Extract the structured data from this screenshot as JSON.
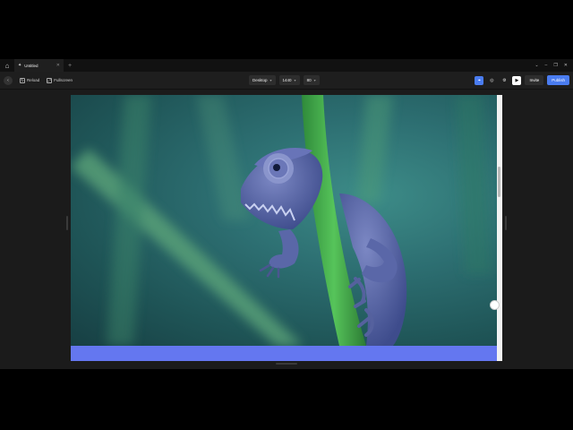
{
  "tabbar": {
    "tab_title": "Untitled",
    "window_controls": [
      "⌄",
      "–",
      "❐",
      "✕"
    ]
  },
  "toolbar": {
    "reload_label": "Reload",
    "fullscreen_label": "Fullscreen",
    "breakpoint_label": "Desktop",
    "width_value": "1440",
    "zoom_value": "80",
    "invite_label": "Invite",
    "publish_label": "Publish"
  },
  "canvas": {
    "image_subject": "chameleon-on-green-stem",
    "footer_color": "#6477f0"
  },
  "colors": {
    "accent": "#4a7cf0",
    "chrome_bg": "#1e1e1e"
  }
}
